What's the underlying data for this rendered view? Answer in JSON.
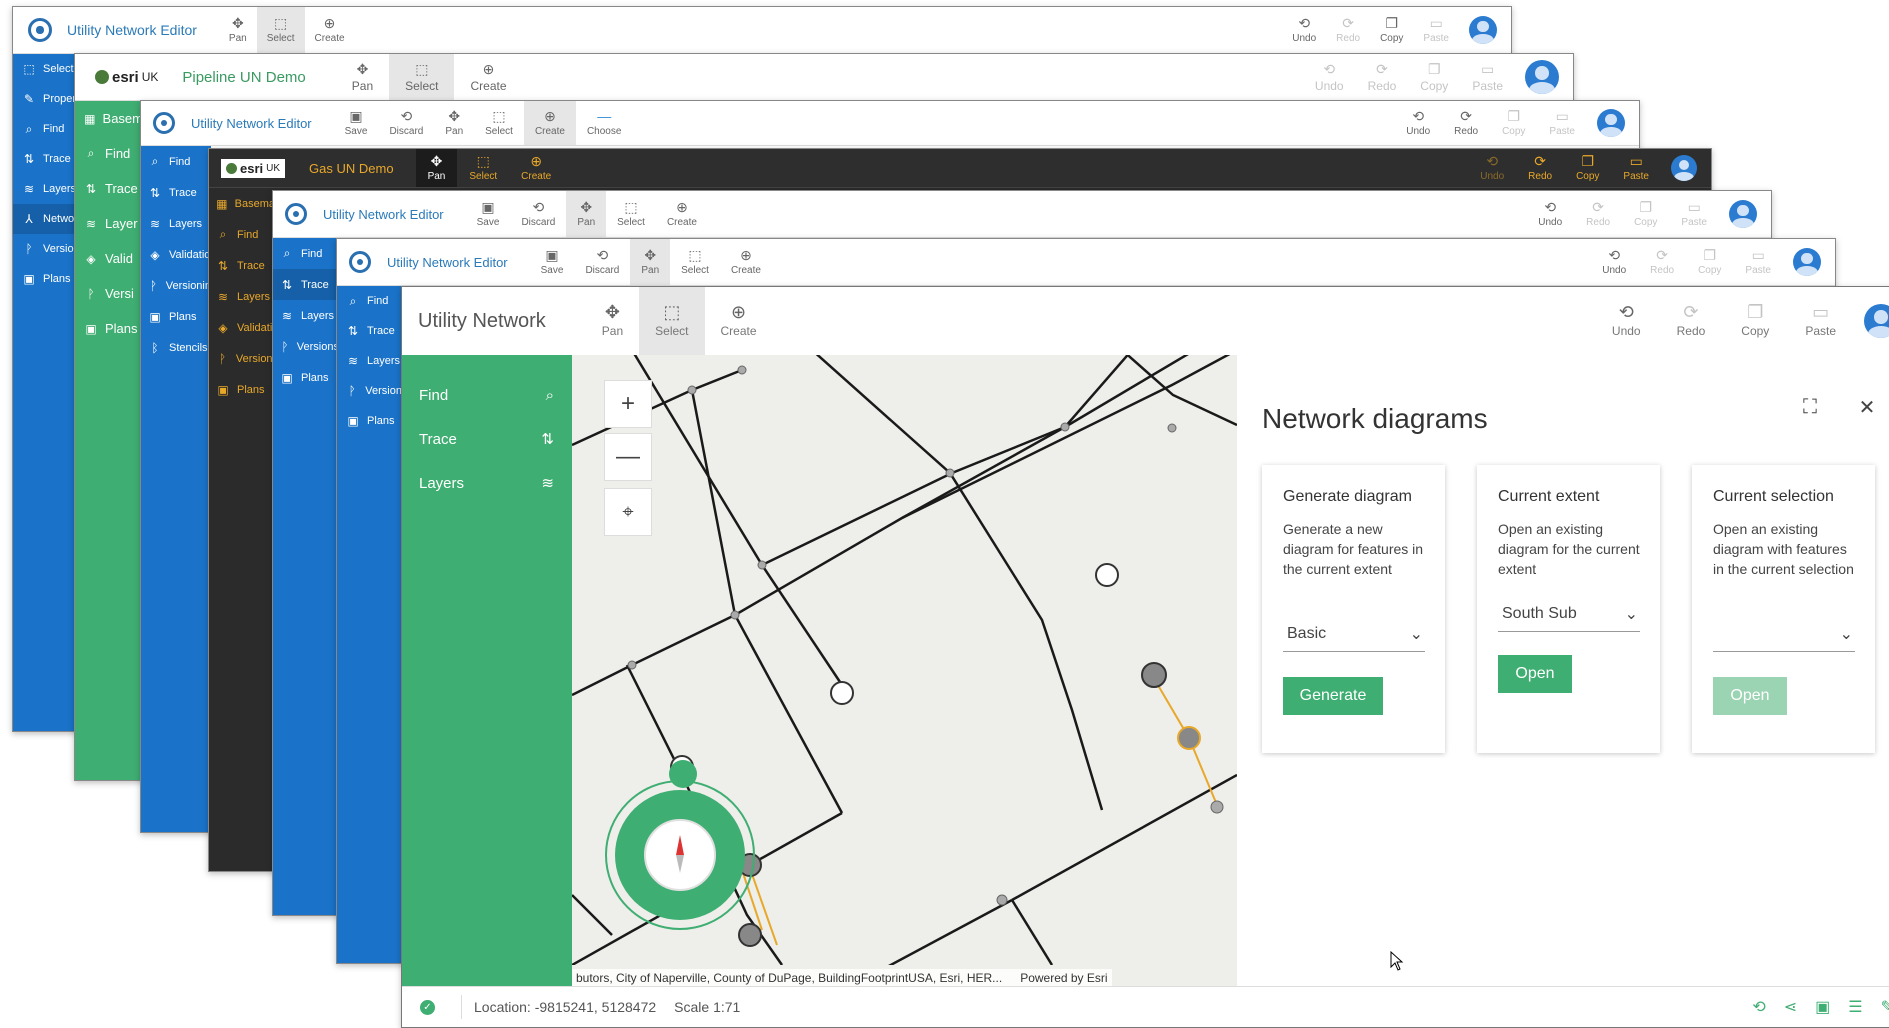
{
  "windows": {
    "w1": {
      "title": "Utility Network Editor",
      "tools": [
        {
          "label": "Pan",
          "icon": "✥"
        },
        {
          "label": "Select",
          "icon": "⬚"
        },
        {
          "label": "Create",
          "icon": "⊕"
        }
      ],
      "right_tools": [
        {
          "label": "Undo",
          "icon": "⟲"
        },
        {
          "label": "Redo",
          "icon": "⟳"
        },
        {
          "label": "Copy",
          "icon": "❐"
        },
        {
          "label": "Paste",
          "icon": "▭"
        }
      ],
      "side": [
        "Selecti",
        "Proper",
        "Find",
        "Trace",
        "Layers",
        "Networ",
        "Version",
        "Plans"
      ]
    },
    "w2": {
      "brand": "esri",
      "brand_suffix": "UK",
      "title": "Pipeline UN Demo",
      "tools": [
        {
          "label": "Pan",
          "icon": "✥"
        },
        {
          "label": "Select",
          "icon": "⬚"
        },
        {
          "label": "Create",
          "icon": "⊕"
        }
      ],
      "right_tools": [
        {
          "label": "Undo",
          "icon": "⟲"
        },
        {
          "label": "Redo",
          "icon": "⟳"
        },
        {
          "label": "Copy",
          "icon": "❐"
        },
        {
          "label": "Paste",
          "icon": "▭"
        }
      ],
      "side": [
        "Basem",
        "Find",
        "Trace",
        "Layer",
        "Valid",
        "Versi",
        "Plans"
      ]
    },
    "w3": {
      "title": "Utility Network Editor",
      "tools": [
        {
          "label": "Save",
          "icon": "▣"
        },
        {
          "label": "Discard",
          "icon": "⟲"
        },
        {
          "label": "Pan",
          "icon": "✥"
        },
        {
          "label": "Select",
          "icon": "⬚"
        },
        {
          "label": "Create",
          "icon": "⊕"
        },
        {
          "label": "Choose",
          "icon": "—"
        }
      ],
      "right_tools": [
        {
          "label": "Undo",
          "icon": "⟲"
        },
        {
          "label": "Redo",
          "icon": "⟳"
        },
        {
          "label": "Copy",
          "icon": "❐"
        },
        {
          "label": "Paste",
          "icon": "▭"
        }
      ],
      "side": [
        "Find",
        "Trace",
        "Layers",
        "Validatio",
        "Versionin",
        "Plans",
        "Stencils"
      ]
    },
    "w4": {
      "brand": "esri",
      "brand_suffix": "UK",
      "title": "Gas UN Demo",
      "tools": [
        {
          "label": "Pan",
          "icon": "✥"
        },
        {
          "label": "Select",
          "icon": "⬚"
        },
        {
          "label": "Create",
          "icon": "⊕"
        }
      ],
      "right_tools": [
        {
          "label": "Undo",
          "icon": "⟲"
        },
        {
          "label": "Redo",
          "icon": "⟳"
        },
        {
          "label": "Copy",
          "icon": "❐"
        },
        {
          "label": "Paste",
          "icon": "▭"
        }
      ],
      "side": [
        "Basema",
        "Find",
        "Trace",
        "Layers",
        "Validati",
        "Versioni",
        "Plans"
      ]
    },
    "w5": {
      "title": "Utility Network Editor",
      "tools": [
        {
          "label": "Save",
          "icon": "▣"
        },
        {
          "label": "Discard",
          "icon": "⟲"
        },
        {
          "label": "Pan",
          "icon": "✥"
        },
        {
          "label": "Select",
          "icon": "⬚"
        },
        {
          "label": "Create",
          "icon": "⊕"
        }
      ],
      "right_tools": [
        {
          "label": "Undo",
          "icon": "⟲"
        },
        {
          "label": "Redo",
          "icon": "⟳"
        },
        {
          "label": "Copy",
          "icon": "❐"
        },
        {
          "label": "Paste",
          "icon": "▭"
        }
      ],
      "side": [
        "Find",
        "Trace",
        "Layers",
        "Versions",
        "Plans"
      ]
    },
    "w6": {
      "title": "Utility Network Editor",
      "tools": [
        {
          "label": "Save",
          "icon": "▣"
        },
        {
          "label": "Discard",
          "icon": "⟲"
        },
        {
          "label": "Pan",
          "icon": "✥"
        },
        {
          "label": "Select",
          "icon": "⬚"
        },
        {
          "label": "Create",
          "icon": "⊕"
        }
      ],
      "right_tools": [
        {
          "label": "Undo",
          "icon": "⟲"
        },
        {
          "label": "Redo",
          "icon": "⟳"
        },
        {
          "label": "Copy",
          "icon": "❐"
        },
        {
          "label": "Paste",
          "icon": "▭"
        }
      ],
      "side": [
        "Find",
        "Trace",
        "Layers",
        "Version",
        "Plans"
      ]
    }
  },
  "main": {
    "title": "Utility Network",
    "tools": [
      {
        "label": "Pan",
        "icon": "✥"
      },
      {
        "label": "Select",
        "icon": "⬚"
      },
      {
        "label": "Create",
        "icon": "⊕"
      }
    ],
    "right_tools": [
      {
        "label": "Undo",
        "icon": "⟲"
      },
      {
        "label": "Redo",
        "icon": "⟳"
      },
      {
        "label": "Copy",
        "icon": "❐"
      },
      {
        "label": "Paste",
        "icon": "▭"
      }
    ],
    "sidebar": [
      {
        "label": "Find",
        "icon": "⌕"
      },
      {
        "label": "Trace",
        "icon": "⇅"
      },
      {
        "label": "Layers",
        "icon": "≋"
      }
    ],
    "map": {
      "zoom_in": "+",
      "zoom_out": "—",
      "locate": "⌖",
      "attribution": "butors, City of Naperville, County of DuPage, BuildingFootprintUSA, Esri, HER...",
      "powered_by": "Powered by Esri"
    },
    "panel": {
      "title": "Network diagrams",
      "expand_icon": "⛶",
      "close_icon": "✕",
      "cards": [
        {
          "title": "Generate diagram",
          "desc": "Generate a new diagram for features in the current extent",
          "select": "Basic",
          "button": "Generate"
        },
        {
          "title": "Current extent",
          "desc": "Open an existing diagram for the current extent",
          "select": "South Sub",
          "button": "Open"
        },
        {
          "title": "Current selection",
          "desc": "Open an existing diagram with features in the current selection",
          "select": "",
          "button": "Open"
        }
      ]
    },
    "status": {
      "location": "Location: -9815241, 5128472",
      "scale": "Scale 1:71"
    }
  },
  "colors": {
    "accent_green": "#3fae72",
    "accent_blue": "#1a73c8",
    "dark": "#2e2e2e",
    "trace_orange": "#e8a82a"
  }
}
